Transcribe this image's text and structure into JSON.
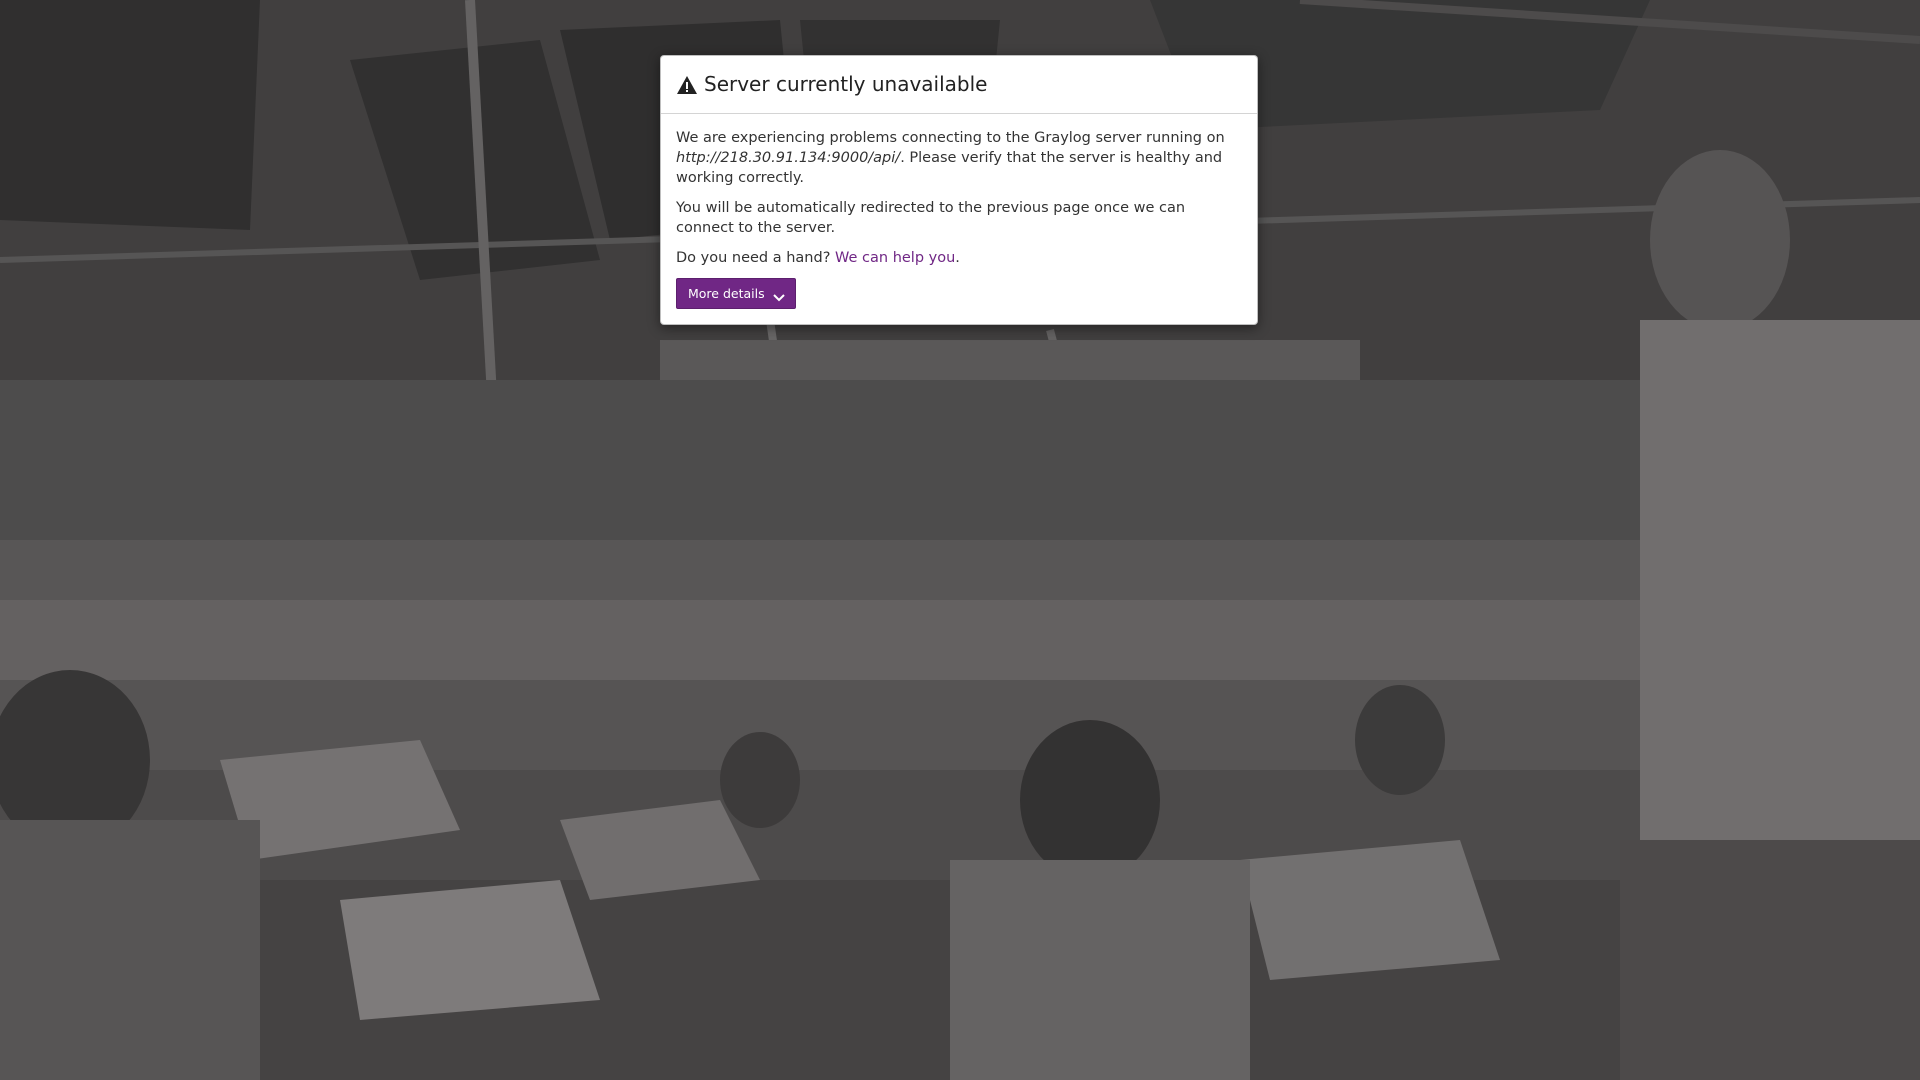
{
  "modal": {
    "title": "Server currently unavailable",
    "title_icon": "warning-triangle-icon",
    "paragraph1_prefix": "We are experiencing problems connecting to the Graylog server running on ",
    "server_url": "http://218.30.91.134:9000/api/",
    "paragraph1_suffix": ". Please verify that the server is healthy and working correctly.",
    "paragraph2": "You will be automatically redirected to the previous page once we can connect to the server.",
    "help_prefix": "Do you need a hand? ",
    "help_link": "We can help you",
    "help_suffix": ".",
    "details_button": "More details",
    "details_icon": "chevron-down-icon"
  },
  "colors": {
    "accent": "#702785",
    "overlay_tint": "#3a3838"
  },
  "background": {
    "description_icon": "background-photo"
  }
}
